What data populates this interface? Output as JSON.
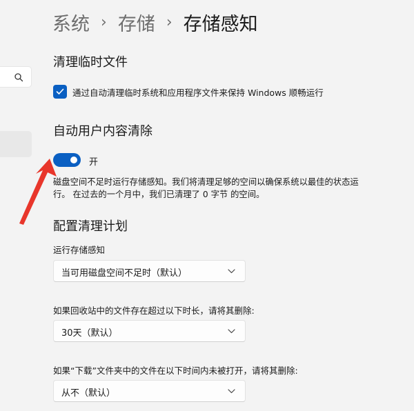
{
  "breadcrumb": {
    "items": [
      "系统",
      "存储",
      "存储感知"
    ],
    "separator": "›"
  },
  "sidebar": {
    "search_icon": "search-icon"
  },
  "temp_files": {
    "title": "清理临时文件",
    "checkbox_label": "通过自动清理临时系统和应用程序文件来保持 Windows 顺畅运行",
    "checked": true
  },
  "auto_cleanup": {
    "title": "自动用户内容清除",
    "toggle_on": true,
    "toggle_label": "开",
    "description": "磁盘空间不足时运行存储感知。我们将清理足够的空间以确保系统以最佳的状态运行。 在过去的一个月中，我们已清理了 0 字节 的空间。"
  },
  "schedule": {
    "title": "配置清理计划",
    "run_label": "运行存储感知",
    "run_value": "当可用磁盘空间不足时（默认）",
    "recycle_label": "如果回收站中的文件存在超过以下时长，请将其删除:",
    "recycle_value": "30天（默认）",
    "downloads_label": "如果“下载”文件夹中的文件在以下时间内未被打开，请将其删除:",
    "downloads_value": "从不（默认）"
  },
  "colors": {
    "accent": "#0a5fc2",
    "background": "#f3f3f3",
    "annotation_arrow": "#e8362b"
  }
}
